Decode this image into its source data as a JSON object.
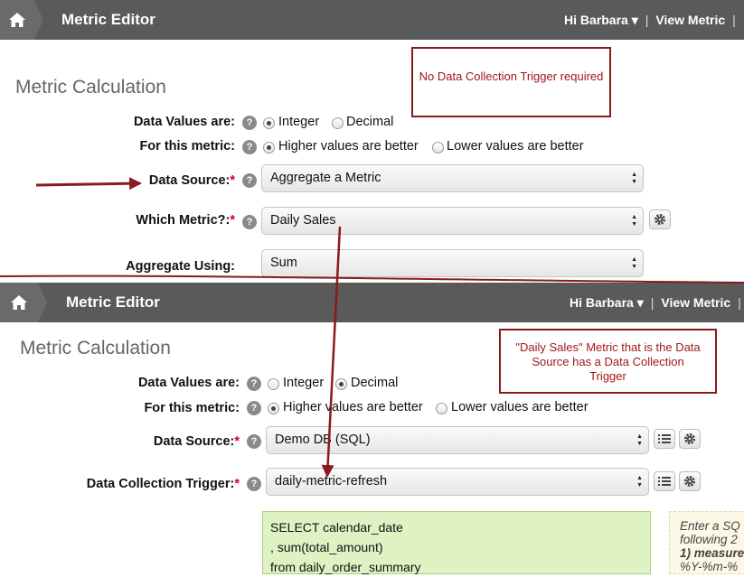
{
  "top": {
    "header": {
      "title": "Metric Editor",
      "user_menu": "Hi Barbara ▾",
      "sep": "|",
      "view_metric": "View Metric",
      "sep2": "|"
    },
    "section_title": "Metric Calculation",
    "callout": "No Data Collection Trigger required",
    "data_values_label": "Data Values are:",
    "data_values_options": [
      "Integer",
      "Decimal"
    ],
    "data_values_selected": "Integer",
    "for_metric_label": "For this metric:",
    "for_metric_options": [
      "Higher values are better",
      "Lower values are better"
    ],
    "data_source_label": "Data Source:",
    "data_source_value": "Aggregate a Metric",
    "which_metric_label": "Which Metric?:",
    "which_metric_value": "Daily Sales",
    "aggregate_label": "Aggregate Using:",
    "aggregate_value": "Sum"
  },
  "bottom": {
    "header": {
      "title": "Metric Editor",
      "user_menu": "Hi Barbara ▾",
      "sep": "|",
      "view_metric": "View Metric",
      "sep2": "|"
    },
    "section_title": "Metric Calculation",
    "callout": "\"Daily Sales\" Metric that is the Data Source has a Data Collection Trigger",
    "data_values_label": "Data Values are:",
    "data_values_options": [
      "Integer",
      "Decimal"
    ],
    "data_values_selected": "Decimal",
    "for_metric_label": "For this metric:",
    "for_metric_options": [
      "Higher values are better",
      "Lower values are better"
    ],
    "data_source_label": "Data Source:",
    "data_source_value": "Demo DB (SQL)",
    "trigger_label": "Data Collection Trigger:",
    "trigger_value": "daily-metric-refresh",
    "sql_lines": [
      "SELECT calendar_date",
      ", sum(total_amount)",
      "from daily_order_summary"
    ],
    "hint_lines": [
      "Enter a SQ",
      "following 2",
      "1) measure",
      "%Y-%m-%"
    ]
  },
  "common": {
    "required_mark": "*",
    "help_glyph": "?"
  },
  "colors": {
    "header": "#5a5a5a",
    "annotation": "#8b1a1a",
    "required": "#d0021b",
    "sql_bg": "#dff2c4"
  },
  "icons": [
    "home-icon",
    "help-icon",
    "gear-icon",
    "list-icon",
    "annotation-arrow"
  ]
}
